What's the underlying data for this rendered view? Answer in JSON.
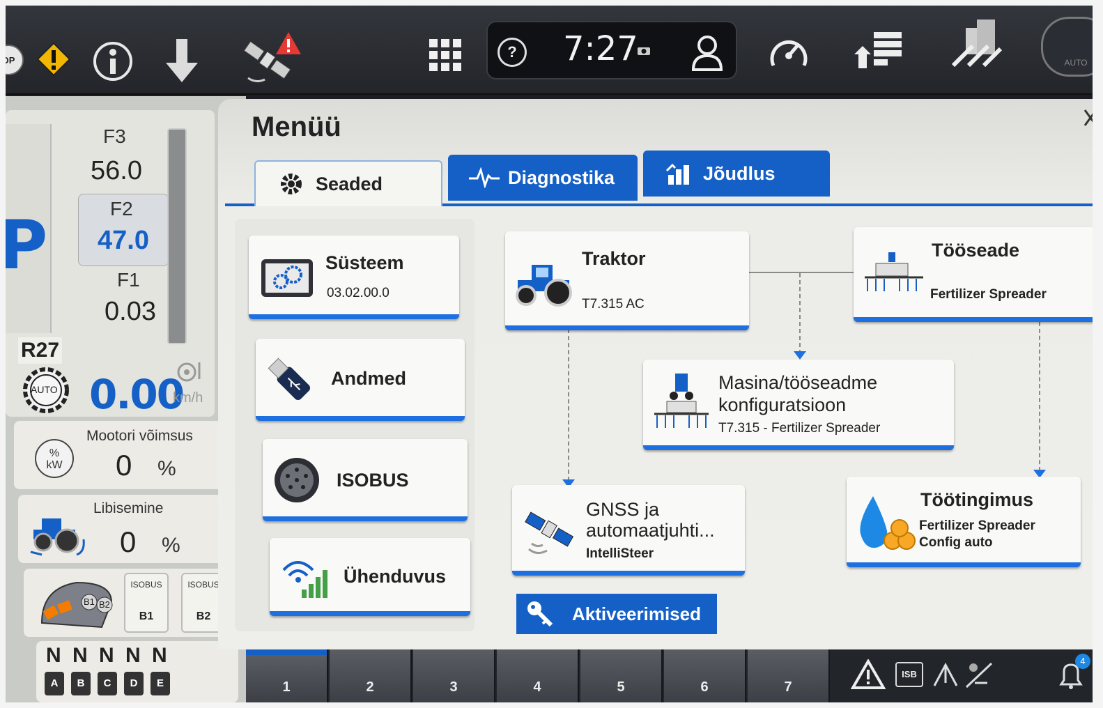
{
  "topbar": {
    "stop_label": "OP",
    "clock": "7:27",
    "help_label": "?",
    "auto_label": "AUTO"
  },
  "left": {
    "gear_label": "P",
    "f3_label": "F3",
    "f3_value": "56.0",
    "f2_label": "F2",
    "f2_value": "47.0",
    "f1_label": "F1",
    "f1_value": "0.03",
    "range_label": "R27",
    "auto_badge": "AUTO",
    "speed_value": "0.00",
    "speed_unit": "km/h",
    "engine_title": "Mootori võimsus",
    "engine_icon_text": "%\nkW",
    "engine_value": "0",
    "engine_unit": "%",
    "slip_title": "Libisemine",
    "slip_value": "0",
    "slip_unit": "%",
    "isobus_b1_tag": "ISOBUS",
    "isobus_b1": "B1",
    "isobus_b2_tag": "ISOBUS",
    "isobus_b2": "B2",
    "joystick_b1": "B1",
    "joystick_b2": "B2",
    "remotes_n": [
      "N",
      "N",
      "N",
      "N",
      "N"
    ],
    "remotes_letters": [
      "A",
      "B",
      "C",
      "D",
      "E"
    ]
  },
  "menu": {
    "title": "Menüü",
    "tabs": [
      {
        "label": "Seaded",
        "icon": "gear-icon"
      },
      {
        "label": "Diagnostika",
        "icon": "pulse-icon"
      },
      {
        "label": "Jõudlus",
        "icon": "performance-icon"
      }
    ],
    "settings_items": [
      {
        "label": "Süsteem",
        "sub": "03.02.00.0",
        "icon": "system-gears-icon"
      },
      {
        "label": "Andmed",
        "sub": "",
        "icon": "usb-icon"
      },
      {
        "label": "ISOBUS",
        "sub": "",
        "icon": "isobus-connector-icon"
      },
      {
        "label": "Ühenduvus",
        "sub": "",
        "icon": "connectivity-icon"
      }
    ],
    "cards": {
      "traktor": {
        "title": "Traktor",
        "sub": "T7.315 AC"
      },
      "tooseade": {
        "title": "Tööseade",
        "sub": "Fertilizer Spreader"
      },
      "config": {
        "title_line1": "Masina/tööseadme",
        "title_line2": "konfiguratsioon",
        "sub": "T7.315 - Fertilizer Spreader"
      },
      "gnss": {
        "title_line1": "GNSS ja",
        "title_line2": "automaatjuhti...",
        "sub": "IntelliSteer"
      },
      "tootingimus": {
        "title": "Töötingimus",
        "sub_line1": "Fertilizer Spreader",
        "sub_line2": "Config auto"
      }
    },
    "activation_label": "Aktiveerimised"
  },
  "bottom": {
    "pages": [
      "1",
      "2",
      "3",
      "4",
      "5",
      "6",
      "7"
    ],
    "isb_label": "ISB",
    "notification_count": "4"
  },
  "colors": {
    "accent": "#1560c7",
    "accent_bright": "#1e6fe0",
    "warning": "#f2b705",
    "alert": "#e53935"
  }
}
